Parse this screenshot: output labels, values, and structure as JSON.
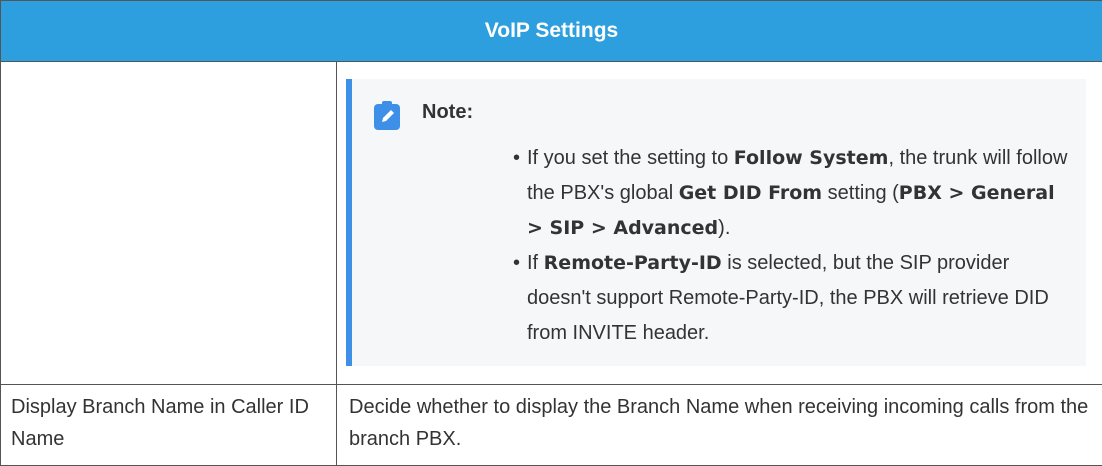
{
  "table": {
    "header": "VoIP Settings",
    "note": {
      "icon": "pencil-note-icon",
      "title": "Note:",
      "bullet1": {
        "t1": "If you set the setting to ",
        "b1": "Follow System",
        "t2": ", the trunk will follow the PBX's global ",
        "b2": "Get DID From",
        "t3": " setting (",
        "b3": "PBX > General > SIP > Advanced",
        "t4": ")."
      },
      "bullet2": {
        "t1": "If ",
        "b1": "Remote-Party-ID",
        "t2": " is selected, but the SIP provider doesn't support Remote-Party-ID, the PBX will retrieve DID from INVITE header."
      }
    },
    "rows": [
      {
        "label": "Display Branch Name in Caller ID Name",
        "description": "Decide whether to display the Branch Name when receiving incoming calls from the branch PBX."
      }
    ]
  },
  "colors": {
    "header_bg": "#2e9fde",
    "note_accent": "#3d8fe8",
    "note_bg": "#f6f7f9"
  }
}
